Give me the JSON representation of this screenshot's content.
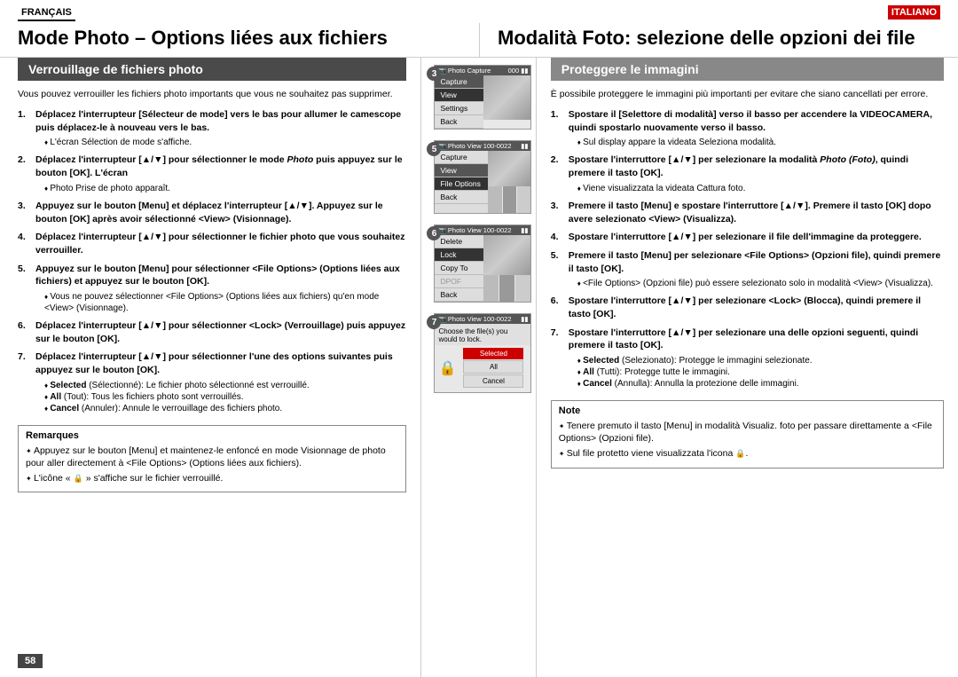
{
  "page": {
    "number": "58"
  },
  "lang_left": {
    "label": "FRANÇAIS"
  },
  "lang_right": {
    "label": "ITALIANO"
  },
  "title_left": {
    "text": "Mode Photo – Options liées aux fichiers"
  },
  "title_right": {
    "text": "Modalità Foto: selezione delle opzioni dei file"
  },
  "section_left": {
    "heading": "Verrouillage de fichiers photo",
    "intro": "Vous pouvez verrouiller les fichiers photo importants que vous ne souhaitez pas supprimer.",
    "steps": [
      {
        "num": "1.",
        "text": "Déplacez l'interrupteur [Sélecteur de mode] vers le bas pour allumer le camescope puis déplacez-le à nouveau vers le bas.",
        "sub": [
          "L'écran Sélection de mode s'affiche."
        ]
      },
      {
        "num": "2.",
        "text": "Déplacez l'interrupteur [▲/▼] pour sélectionner le mode Photo puis appuyez sur le bouton [OK]. L'écran",
        "sub": [
          "Photo Prise de photo apparaît."
        ]
      },
      {
        "num": "3.",
        "text": "Appuyez sur le bouton [Menu] et déplacez l'interrupteur [▲/▼]. Appuyez sur le bouton [OK] après avoir sélectionné <View> (Visionnage)."
      },
      {
        "num": "4.",
        "text": "Déplacez l'interrupteur [▲/▼] pour sélectionner le fichier photo que vous souhaitez verrouiller."
      },
      {
        "num": "5.",
        "text": "Appuyez sur le bouton [Menu] pour sélectionner <File Options> (Options liées aux fichiers) et appuyez sur le bouton [OK].",
        "sub": [
          "Vous ne pouvez sélectionner <File Options> (Options liées aux fichiers) qu'en mode <View> (Visionnage)."
        ]
      },
      {
        "num": "6.",
        "text": "Déplacez l'interrupteur [▲/▼] pour sélectionner <Lock> (Verrouillage) puis appuyez sur le bouton [OK]."
      },
      {
        "num": "7.",
        "text": "Déplacez l'interrupteur [▲/▼] pour sélectionner l'une des options suivantes puis appuyez sur le bouton [OK].",
        "sub": [
          "Selected (Sélectionné): Le fichier photo sélectionné est verrouillé.",
          "All (Tout): Tous les fichiers photo sont verrouillés.",
          "Cancel (Annuler): Annule le verrouillage des fichiers photo."
        ]
      }
    ],
    "remarques": {
      "title": "Remarques",
      "items": [
        "Appuyez sur le bouton [Menu] et maintenez-le enfoncé en mode Visionnage de photo pour aller directement à <File Options> (Options liées aux fichiers).",
        "L'icône « 🔒 » s'affiche sur le fichier verrouillé."
      ]
    }
  },
  "section_right": {
    "heading": "Proteggere le immagini",
    "intro": "È possibile proteggere le immagini più importanti per evitare che siano cancellati per errore.",
    "steps": [
      {
        "num": "1.",
        "text": "Spostare il [Selettore di modalità] verso il basso per accendere la VIDEOCAMERA, quindi spostarlo nuovamente verso il basso.",
        "sub": [
          "Sul display appare la videata Seleziona modalità."
        ]
      },
      {
        "num": "2.",
        "text": "Spostare l'interruttore [▲/▼] per selezionare la modalità Photo (Foto), quindi premere il tasto [OK].",
        "sub": [
          "Viene visualizzata la videata Cattura foto."
        ]
      },
      {
        "num": "3.",
        "text": "Premere il tasto [Menu] e spostare l'interruttore [▲/▼]. Premere il tasto [OK] dopo avere selezionato <View> (Visualizza)."
      },
      {
        "num": "4.",
        "text": "Spostare l'interruttore [▲/▼] per selezionare il file dell'immagine da proteggere."
      },
      {
        "num": "5.",
        "text": "Premere il tasto [Menu] per selezionare <File Options> (Opzioni file), quindi premere il tasto [OK].",
        "sub": [
          "<File Options> (Opzioni file) può essere selezionato solo in modalità <View> (Visualizza)."
        ]
      },
      {
        "num": "6.",
        "text": "Spostare l'interruttore [▲/▼] per selezionare <Lock> (Blocca), quindi premere il tasto [OK]."
      },
      {
        "num": "7.",
        "text": "Spostare l'interruttore [▲/▼] per selezionare una delle opzioni seguenti, quindi premere il tasto [OK].",
        "sub": [
          "Selected (Selezionato): Protegge le immagini selezionate.",
          "All (Tutti): Protegge tutte le immagini.",
          "Cancel (Annulla): Annulla la protezione delle immagini."
        ]
      }
    ],
    "note": {
      "title": "Note",
      "items": [
        "Tenere premuto il tasto [Menu] in modalità Visualiz. foto per passare direttamente a <File Options> (Opzioni file).",
        "Sul file protetto viene visualizzata l'icona 🔒."
      ]
    }
  },
  "screenshots": [
    {
      "step": "3",
      "title": "Photo Capture",
      "title_right": "000",
      "menu_items": [
        "Capture",
        "View",
        "Settings",
        "Back"
      ],
      "active": "View",
      "has_image": true
    },
    {
      "step": "5",
      "title": "Photo View 100-0022",
      "menu_items": [
        "Capture",
        "View",
        "File Options",
        "Back"
      ],
      "active": "File Options",
      "has_thumbnails": true
    },
    {
      "step": "6",
      "title": "Photo View 100-0022",
      "menu_items": [
        "Delete",
        "Lock",
        "Copy To",
        "DPOF",
        "Back"
      ],
      "active": "Lock",
      "has_thumbnails": true
    },
    {
      "step": "7",
      "title": "Photo View 100-0022",
      "prompt": "Choose the file(s) you would to lock.",
      "buttons": [
        "Selected",
        "All",
        "Cancel"
      ],
      "selected_btn": "Selected"
    }
  ]
}
